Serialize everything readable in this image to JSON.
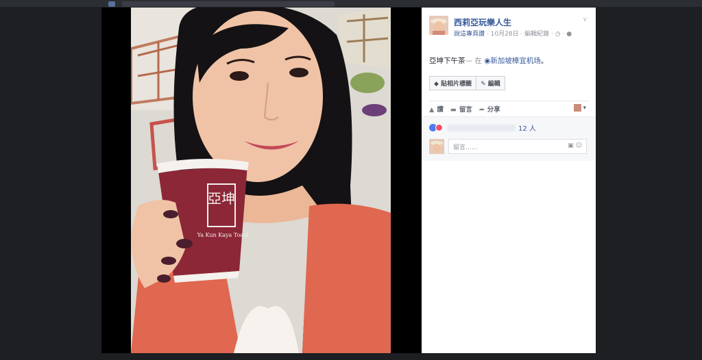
{
  "post": {
    "page_name": "西莉亞玩樂人生",
    "like_page": "說這專頁讚",
    "date": "10月28日",
    "edit_history": "編輯紀錄",
    "caption_text": "亞坤下午茶",
    "caption_at": "— 在",
    "location": "新加坡樟宜机场",
    "caption_end": "。",
    "tag_photo": "貼相片標籤",
    "edit": "編輯"
  },
  "actions": {
    "like": "讚",
    "comment": "留言",
    "share": "分享"
  },
  "reactions": {
    "count": "12 人"
  },
  "comment": {
    "placeholder": "留言……"
  },
  "cup": {
    "logo": "亞坤",
    "brand": "Ya Kun Kaya Toast"
  },
  "colors": {
    "link": "#365899",
    "cup": "#8c2737",
    "shirt": "#e06750"
  }
}
